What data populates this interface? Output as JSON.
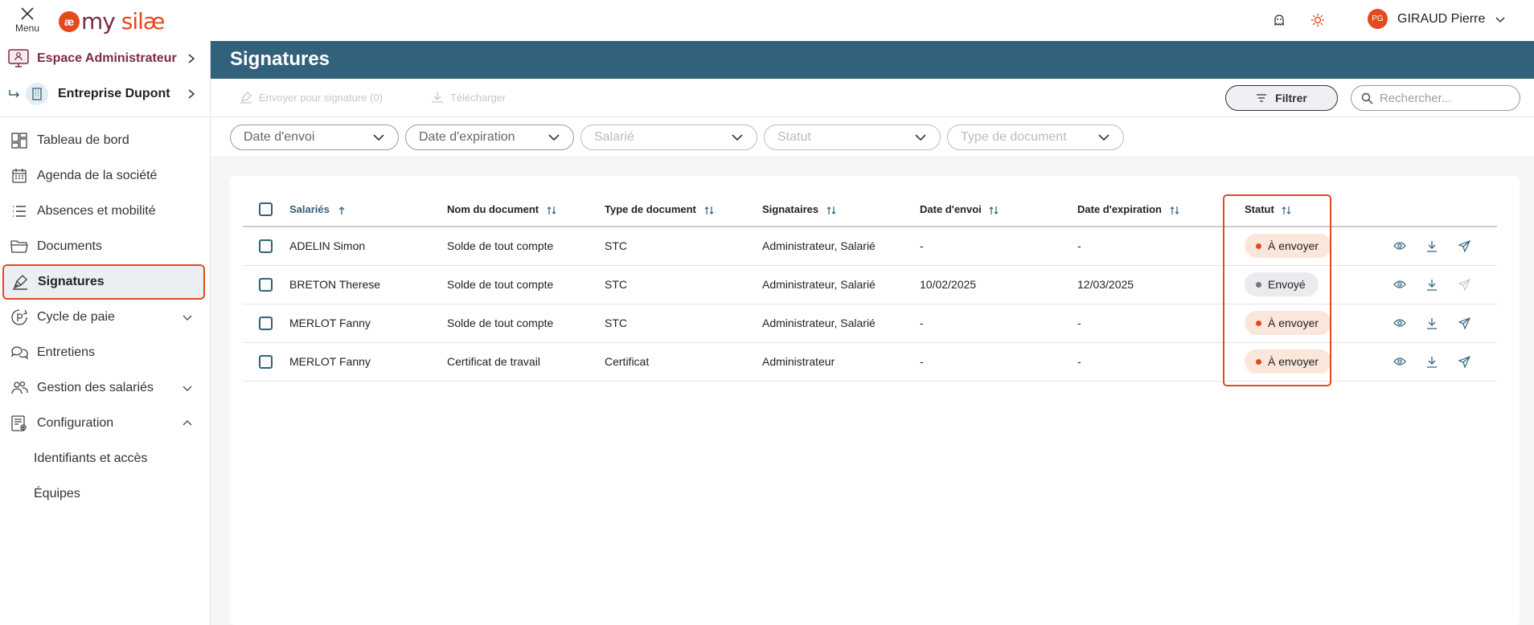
{
  "app": {
    "menu_label": "Menu",
    "logo_ae": "æ",
    "logo_my": "my",
    "logo_rest": " silæ"
  },
  "user": {
    "initials": "PG",
    "name": "GIRAUD Pierre"
  },
  "sidebar": {
    "context": [
      {
        "label": "Espace Administrateur",
        "color": "#7d2a48"
      },
      {
        "label": "Entreprise Dupont",
        "color": "#222222"
      }
    ],
    "items": [
      {
        "label": "Tableau de bord",
        "icon": "dashboard-icon"
      },
      {
        "label": "Agenda de la société",
        "icon": "calendar-icon"
      },
      {
        "label": "Absences et mobilité",
        "icon": "list-icon"
      },
      {
        "label": "Documents",
        "icon": "folder-icon"
      },
      {
        "label": "Signatures",
        "icon": "pen-icon",
        "active": true
      },
      {
        "label": "Cycle de paie",
        "icon": "payroll-icon",
        "expandable": "down"
      },
      {
        "label": "Entretiens",
        "icon": "chat-icon"
      },
      {
        "label": "Gestion des salariés",
        "icon": "people-icon",
        "expandable": "down"
      },
      {
        "label": "Configuration",
        "icon": "settings-doc-icon",
        "expandable": "up"
      }
    ],
    "sub_items": [
      "Identifiants et accès",
      "Équipes"
    ]
  },
  "page": {
    "title": "Signatures"
  },
  "toolbar": {
    "send_label": "Envoyer pour signature (0)",
    "download_label": "Télécharger",
    "filter_label": "Filtrer",
    "search_placeholder": "Rechercher..."
  },
  "filters": [
    "Date d'envoi",
    "Date d'expiration",
    "Salarié",
    "Statut",
    "Type de document"
  ],
  "table": {
    "columns": [
      "Salariés",
      "Nom du document",
      "Type de document",
      "Signataires",
      "Date d'envoi",
      "Date d'expiration",
      "Statut"
    ],
    "rows": [
      {
        "employee": "ADELIN Simon",
        "document": "Solde de tout compte",
        "type": "STC",
        "signers": "Administrateur, Salarié",
        "sent": "-",
        "expires": "-",
        "status": "À envoyer"
      },
      {
        "employee": "BRETON Therese",
        "document": "Solde de tout compte",
        "type": "STC",
        "signers": "Administrateur, Salarié",
        "sent": "10/02/2025",
        "expires": "12/03/2025",
        "status": "Envoyé"
      },
      {
        "employee": "MERLOT Fanny",
        "document": "Solde de tout compte",
        "type": "STC",
        "signers": "Administrateur, Salarié",
        "sent": "-",
        "expires": "-",
        "status": "À envoyer"
      },
      {
        "employee": "MERLOT Fanny",
        "document": "Certificat de travail",
        "type": "Certificat",
        "signers": "Administrateur",
        "sent": "-",
        "expires": "-",
        "status": "À envoyer"
      }
    ]
  },
  "colors": {
    "header": "#32617c",
    "accent": "#e4491f",
    "brand": "#7d2a48"
  }
}
